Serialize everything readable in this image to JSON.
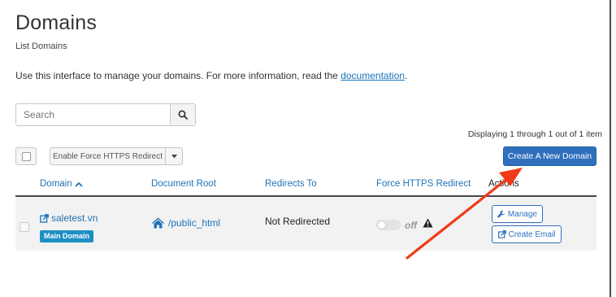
{
  "page": {
    "title": "Domains",
    "subtitle": "List Domains",
    "intro_text": "Use this interface to manage your domains. For more information, read the ",
    "intro_link": "documentation",
    "intro_end": "."
  },
  "search": {
    "placeholder": "Search",
    "icon": "search-icon"
  },
  "pagination": {
    "displaying": "Displaying 1 through 1 out of 1 item"
  },
  "toolbar": {
    "force_https_label": "Enable Force HTTPS Redirect",
    "create_domain_label": "Create A New Domain"
  },
  "table": {
    "columns": {
      "domain": "Domain",
      "document_root": "Document Root",
      "redirects_to": "Redirects To",
      "force_https": "Force HTTPS Redirect",
      "actions": "Actions"
    },
    "rows": [
      {
        "domain": "saletest.vn",
        "badge": "Main Domain",
        "document_root": "/public_html",
        "redirects_to": "Not Redirected",
        "force_https_state": "off",
        "actions": {
          "manage": "Manage",
          "create_email": "Create Email"
        }
      }
    ]
  },
  "colors": {
    "primary": "#2f6fbe",
    "link": "#1f73b7",
    "badge": "#1d8fc4",
    "annotation_arrow": "#f03a17"
  }
}
